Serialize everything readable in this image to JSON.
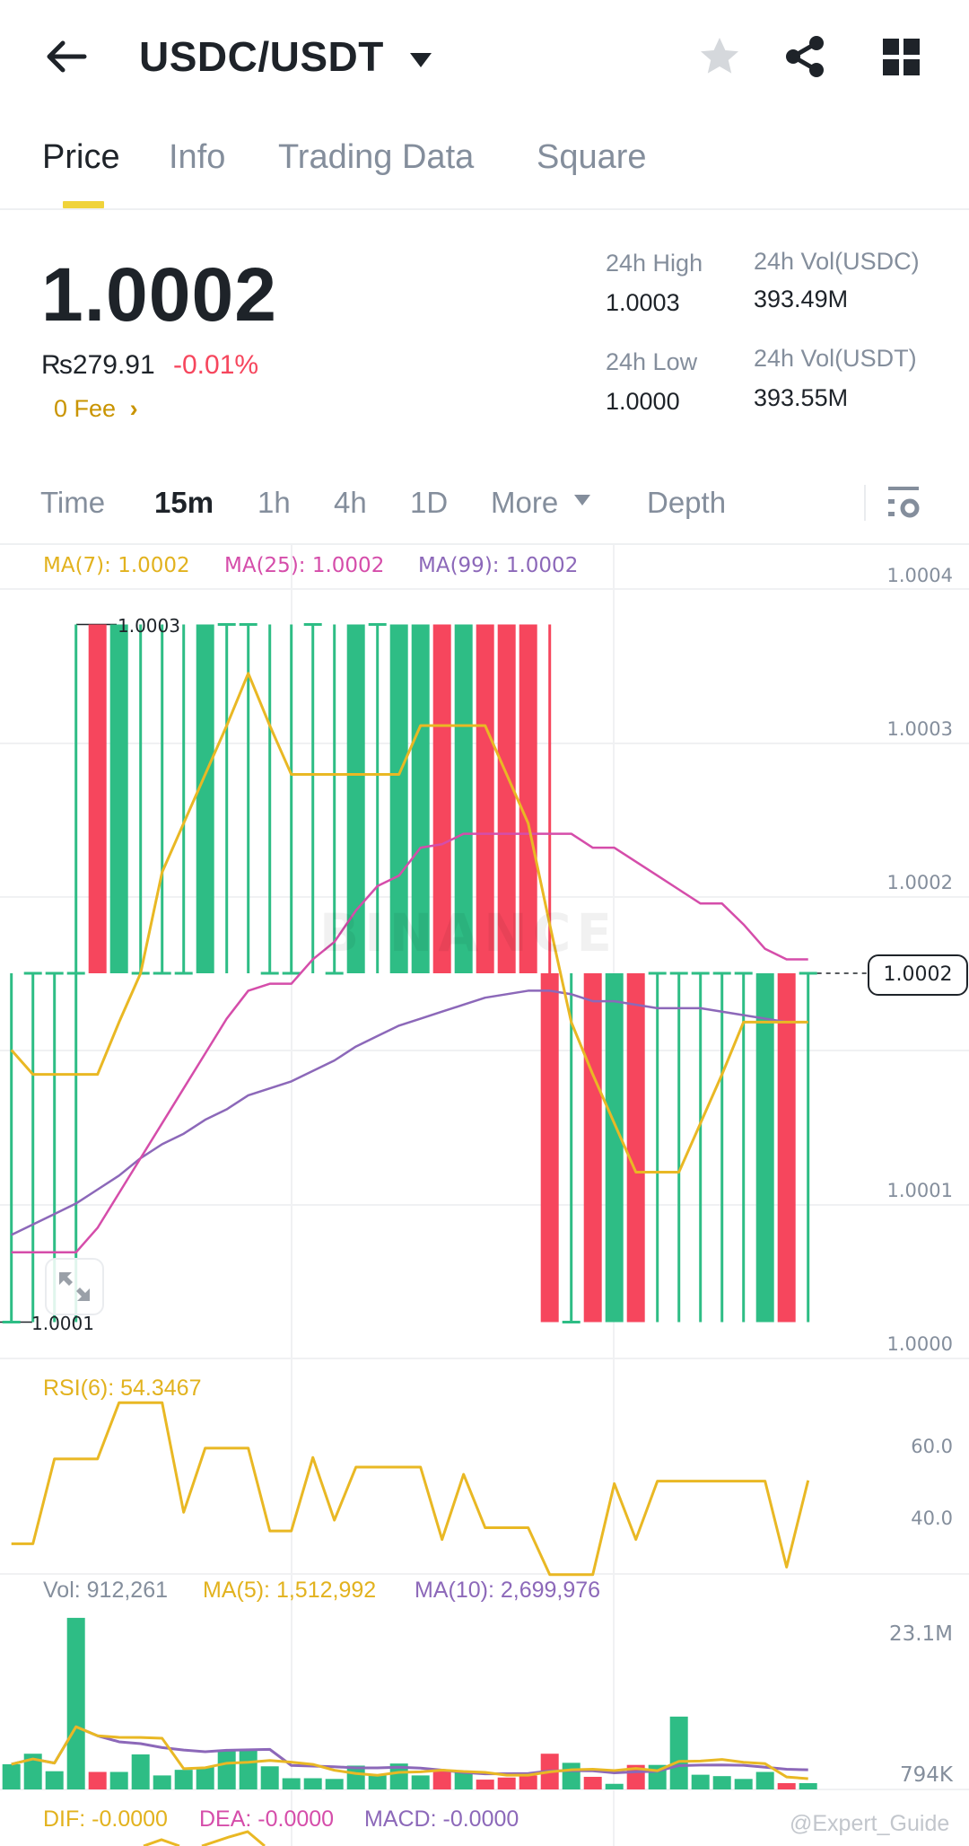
{
  "header": {
    "title": "USDC/USDT",
    "back_icon": "arrow-left-icon",
    "favorite_icon": "star-icon",
    "share_icon": "share-icon",
    "more_icon": "grid-icon"
  },
  "tabs": [
    {
      "label": "Price"
    },
    {
      "label": "Info"
    },
    {
      "label": "Trading Data"
    },
    {
      "label": "Square"
    }
  ],
  "ticker": {
    "last_price": "1.0002",
    "fiat_price": "₨279.91",
    "change": "-0.01%",
    "fee_label": "0 Fee",
    "high_label": "24h High",
    "high": "1.0003",
    "low_label": "24h Low",
    "low": "1.0000",
    "vol_base_label": "24h Vol(USDC)",
    "vol_base": "393.49M",
    "vol_quote_label": "24h Vol(USDT)",
    "vol_quote": "393.55M"
  },
  "timeframes": [
    {
      "label": "Time"
    },
    {
      "label": "15m"
    },
    {
      "label": "1h"
    },
    {
      "label": "4h"
    },
    {
      "label": "1D"
    },
    {
      "label": "More"
    },
    {
      "label": "Depth"
    }
  ],
  "colors": {
    "up": "#2EBD85",
    "down": "#F6465D",
    "ma7": "#E9B824",
    "ma25": "#D54DAA",
    "ma99": "#8C68B9",
    "accent": "#F0B90B"
  },
  "chart_data": [
    {
      "type": "candlestick",
      "title": "USDC/USDT 15m",
      "legend": {
        "ma7": "MA(7): 1.0002",
        "ma25": "MA(25): 1.0002",
        "ma99": "MA(99): 1.0002"
      },
      "y_ticks": [
        "1.0004",
        "1.0003",
        "1.0002",
        "1.0001",
        "1.0000"
      ],
      "last_price_label": "1.0002",
      "high_marker": "1.0003",
      "low_marker": "1.0001",
      "watermark": "BINANCE",
      "ylim": [
        1.00008,
        1.00041
      ],
      "candles": [
        [
          1.0001,
          1.0002,
          1.0001,
          1.0001
        ],
        [
          1.0002,
          1.0002,
          1.0001,
          1.0002
        ],
        [
          1.0002,
          1.0002,
          1.0001,
          1.0002
        ],
        [
          1.0002,
          1.0003,
          1.0001,
          1.0002
        ],
        [
          1.0003,
          1.0003,
          1.0002,
          1.0002
        ],
        [
          1.0002,
          1.0003,
          1.0002,
          1.0003
        ],
        [
          1.0002,
          1.0003,
          1.0002,
          1.0002
        ],
        [
          1.0002,
          1.0003,
          1.0002,
          1.0002
        ],
        [
          1.0002,
          1.0003,
          1.0002,
          1.0002
        ],
        [
          1.0002,
          1.0003,
          1.0002,
          1.0003
        ],
        [
          1.0003,
          1.0003,
          1.0002,
          1.0003
        ],
        [
          1.0003,
          1.0003,
          1.0002,
          1.0003
        ],
        [
          1.0002,
          1.0003,
          1.0002,
          1.0002
        ],
        [
          1.0002,
          1.0003,
          1.0002,
          1.0002
        ],
        [
          1.0003,
          1.0003,
          1.0002,
          1.0003
        ],
        [
          1.0002,
          1.0003,
          1.0002,
          1.0002
        ],
        [
          1.0002,
          1.0003,
          1.0002,
          1.0003
        ],
        [
          1.0003,
          1.0003,
          1.0002,
          1.0003
        ],
        [
          1.0002,
          1.0003,
          1.0002,
          1.0003
        ],
        [
          1.0002,
          1.0003,
          1.0002,
          1.0003
        ],
        [
          1.0003,
          1.0003,
          1.0002,
          1.0002
        ],
        [
          1.0002,
          1.0003,
          1.0002,
          1.0003
        ],
        [
          1.0003,
          1.0003,
          1.0002,
          1.0002
        ],
        [
          1.0003,
          1.0003,
          1.0002,
          1.0002
        ],
        [
          1.0003,
          1.0003,
          1.0002,
          1.0002
        ],
        [
          1.0002,
          1.0003,
          1.0001,
          1.0001
        ],
        [
          1.0001,
          1.0002,
          1.0001,
          1.0001
        ],
        [
          1.0002,
          1.0002,
          1.0001,
          1.0001
        ],
        [
          1.0001,
          1.0002,
          1.0001,
          1.0002
        ],
        [
          1.0002,
          1.0002,
          1.0001,
          1.0001
        ],
        [
          1.0002,
          1.0002,
          1.0001,
          1.0002
        ],
        [
          1.0002,
          1.0002,
          1.0001,
          1.0002
        ],
        [
          1.0002,
          1.0002,
          1.0001,
          1.0002
        ],
        [
          1.0002,
          1.0002,
          1.0001,
          1.0002
        ],
        [
          1.0002,
          1.0002,
          1.0001,
          1.0002
        ],
        [
          1.0001,
          1.0002,
          1.0001,
          1.0002
        ],
        [
          1.0002,
          1.0002,
          1.0001,
          1.0001
        ],
        [
          1.0002,
          1.0002,
          1.0001,
          1.0002
        ]
      ],
      "candle_format": [
        "open",
        "high",
        "low",
        "close"
      ],
      "ma7": [
        1.000178,
        1.000171,
        1.000171,
        1.000171,
        1.000171,
        1.000186,
        1.0002,
        1.000229,
        1.000243,
        1.000257,
        1.000271,
        1.000286,
        1.000271,
        1.000257,
        1.000257,
        1.000257,
        1.000257,
        1.000257,
        1.000257,
        1.000271,
        1.000271,
        1.000271,
        1.000271,
        1.000257,
        1.000243,
        1.000214,
        1.000186,
        1.000171,
        1.000157,
        1.000143,
        1.000143,
        1.000143,
        1.000157,
        1.000171,
        1.000186,
        1.000186,
        1.000186,
        1.000186
      ],
      "ma25": [
        1.00012,
        1.00012,
        1.00012,
        1.00012,
        1.000127,
        1.000137,
        1.000147,
        1.000157,
        1.000167,
        1.000177,
        1.000187,
        1.000195,
        1.000197,
        1.000197,
        1.000204,
        1.000209,
        1.000218,
        1.000225,
        1.000228,
        1.000236,
        1.000237,
        1.00024,
        1.00024,
        1.00024,
        1.00024,
        1.00024,
        1.00024,
        1.000236,
        1.000236,
        1.000232,
        1.000228,
        1.000224,
        1.00022,
        1.00022,
        1.000214,
        1.000207,
        1.000204,
        1.000204
      ],
      "ma99": [
        1.000125,
        1.000128,
        1.000131,
        1.000134,
        1.000138,
        1.000142,
        1.000147,
        1.000151,
        1.000154,
        1.000158,
        1.000161,
        1.000165,
        1.000167,
        1.000169,
        1.000172,
        1.000175,
        1.000179,
        1.000182,
        1.000185,
        1.000187,
        1.000189,
        1.000191,
        1.000193,
        1.000194,
        1.000195,
        1.000195,
        1.000194,
        1.000192,
        1.000192,
        1.000191,
        1.00019,
        1.00019,
        1.00019,
        1.000189,
        1.000188,
        1.000187,
        1.000186,
        1.000186
      ]
    },
    {
      "type": "line",
      "title": "RSI(6): 54.3467",
      "y_ticks": [
        "60.0",
        "40.0"
      ],
      "values": [
        33,
        33,
        56.7,
        56.7,
        56.7,
        72.4,
        72.4,
        72.4,
        41.8,
        59.7,
        59.7,
        59.7,
        36.6,
        36.6,
        57.1,
        39.6,
        54.4,
        54.4,
        54.4,
        54.4,
        34.2,
        52.4,
        37.5,
        37.5,
        37.5,
        24.4,
        24.4,
        24.4,
        49.8,
        34.2,
        50.5,
        50.5,
        50.5,
        50.5,
        50.5,
        50.5,
        26.5,
        50.7
      ]
    },
    {
      "type": "bar",
      "legend": {
        "vol": "Vol: 912,261",
        "ma5": "MA(5): 1,512,992",
        "ma10": "MA(10): 2,699,976"
      },
      "y_ticks": [
        "23.1M",
        "794K"
      ],
      "unit": "M",
      "values": [
        3.6,
        5.1,
        2.6,
        24.5,
        2.5,
        2.5,
        5.0,
        2.0,
        2.8,
        3.2,
        5.7,
        5.7,
        3.3,
        1.6,
        1.6,
        1.5,
        3.4,
        2.0,
        3.7,
        2.0,
        2.7,
        2.4,
        1.4,
        1.7,
        2.0,
        5.1,
        3.8,
        1.8,
        0.8,
        3.5,
        3.5,
        10.4,
        2.1,
        1.9,
        1.5,
        2.5,
        0.9,
        0.9
      ]
    },
    {
      "type": "line",
      "legend": {
        "dif": "DIF: -0.0000",
        "dea": "DEA: -0.0000",
        "macd": "MACD: -0.0000"
      }
    }
  ],
  "watermark": "@Expert_Guide"
}
